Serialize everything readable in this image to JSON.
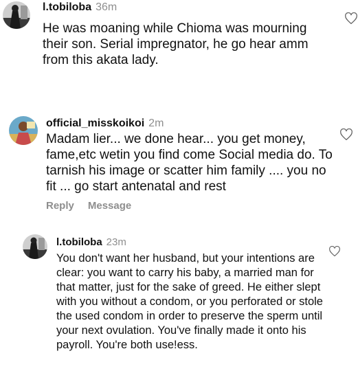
{
  "comments": [
    {
      "username": "l.tobiloba",
      "time": "36m",
      "text": "He was moaning while Chioma was mourning their son. Serial impregnator, he go hear amm from this akata lady."
    },
    {
      "username": "official_misskoikoi",
      "time": "2m",
      "text": "Madam lier... we done hear... you get money, fame,etc wetin you find come Social media do. To tarnish his image or scatter him family .... you no fit ... go start antenatal and rest",
      "actions": {
        "reply_label": "Reply",
        "message_label": "Message"
      }
    },
    {
      "username": "l.tobiloba",
      "time": "23m",
      "text": "You don't want her husband, but your intentions are clear: you want to carry his baby, a married man for that matter, just for the sake of greed. He either slept with you without a condom, or you perforated or stole the used condom in order to preserve the sperm until your next ovulation. You've finally made it onto his payroll. You're both use!ess."
    }
  ],
  "icons": {
    "like": "heart-outline-icon"
  },
  "colors": {
    "text": "#111111",
    "secondary": "#8e8e8e"
  }
}
